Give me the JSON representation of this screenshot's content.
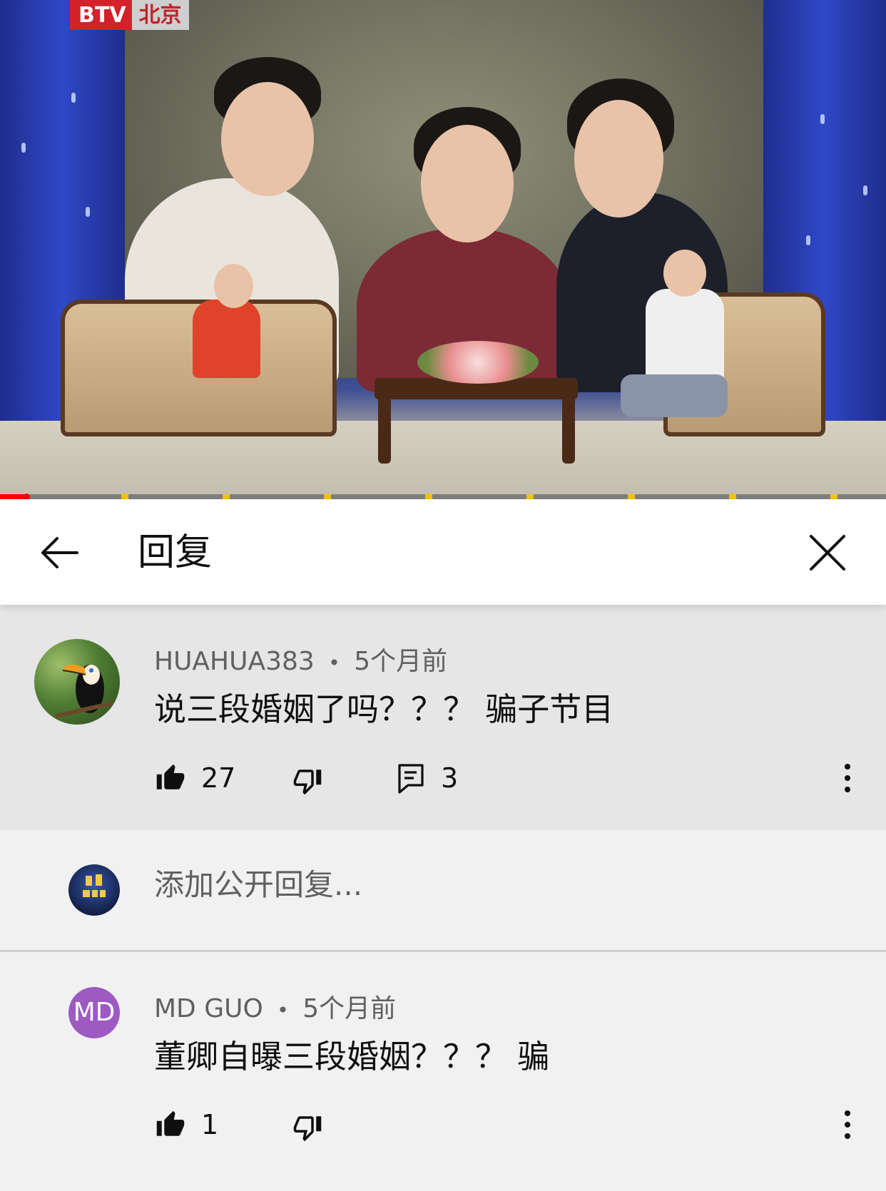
{
  "video": {
    "channel_logo_left": "BTV",
    "channel_logo_right": "北京",
    "progress_fraction": 0.03
  },
  "header": {
    "title": "回复",
    "back_icon": "arrow-left-icon",
    "close_icon": "close-icon"
  },
  "comment": {
    "author": "HUAHUA383",
    "separator": "•",
    "time": "5个月前",
    "text": "说三段婚姻了吗？？？ 骗子节目",
    "likes": "27",
    "replies": "3"
  },
  "reply_box": {
    "placeholder": "添加公开回复..."
  },
  "replies": [
    {
      "author": "MD GUO",
      "separator": "•",
      "time": "5个月前",
      "avatar_initials": "MD",
      "avatar_color": "#9c5ac2",
      "text": "董卿自曝三段婚姻？？？ 骗",
      "likes": "1"
    }
  ]
}
